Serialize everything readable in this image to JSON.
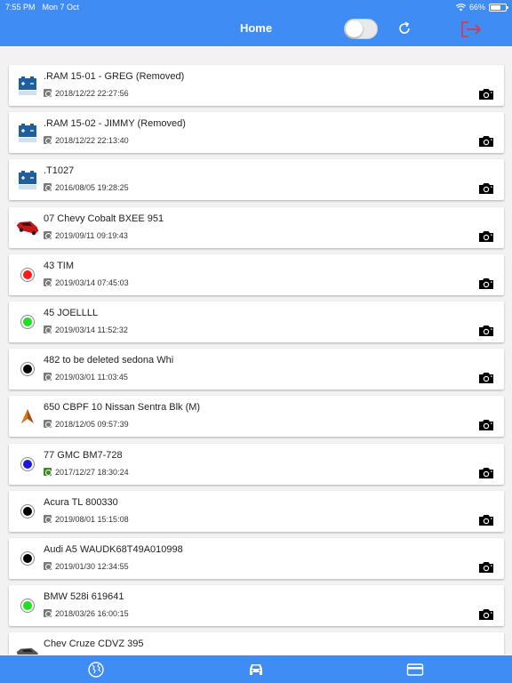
{
  "status_bar": {
    "time": "7:55 PM",
    "date": "Mon 7 Oct",
    "battery": "66%",
    "battery_level": 0.66
  },
  "nav": {
    "title": "Home",
    "toggle_on": false
  },
  "colors": {
    "accent": "#3f8cf5",
    "logout": "#e0314a"
  },
  "vehicles": [
    {
      "name": ".RAM 15-01 - GREG (Removed)",
      "date": "2018/12/22 22:27:56",
      "icon": "battery-icon",
      "date_icon": "gray"
    },
    {
      "name": ".RAM 15-02 - JIMMY (Removed)",
      "date": "2018/12/22 22:13:40",
      "icon": "battery-icon",
      "date_icon": "gray"
    },
    {
      "name": ".T1027",
      "date": "2016/08/05 19:28:25",
      "icon": "battery-icon",
      "date_icon": "gray"
    },
    {
      "name": "07 Chevy Cobalt BXEE 951",
      "date": "2019/09/11 09:19:43",
      "icon": "red-car-icon",
      "date_icon": "gray"
    },
    {
      "name": "43 TIM",
      "date": "2019/03/14 07:45:03",
      "icon": "red-dot-icon",
      "date_icon": "gray"
    },
    {
      "name": "45 JOELLLL",
      "date": "2019/03/14 11:52:32",
      "icon": "green-dot-icon",
      "date_icon": "gray"
    },
    {
      "name": "482 to be deleted sedona Whi",
      "date": "2019/03/01 11:03:45",
      "icon": "black-dot-icon",
      "date_icon": "gray"
    },
    {
      "name": "650 CBPF 10 Nissan Sentra Blk (M)",
      "date": "2018/12/05 09:57:39",
      "icon": "arrow-icon",
      "date_icon": "gray"
    },
    {
      "name": "77 GMC BM7-728",
      "date": "2017/12/27 18:30:24",
      "icon": "blue-dot-icon",
      "date_icon": "green"
    },
    {
      "name": "Acura TL 800330",
      "date": "2019/08/01 15:15:08",
      "icon": "black-dot-icon",
      "date_icon": "gray"
    },
    {
      "name": "Audi A5 WAUDK68T49A010998",
      "date": "2019/01/30 12:34:55",
      "icon": "black-dot-icon",
      "date_icon": "gray"
    },
    {
      "name": "BMW 528i 619641",
      "date": "2018/03/26 16:00:15",
      "icon": "green-dot-icon",
      "date_icon": "gray"
    },
    {
      "name": "Chev Cruze CDVZ 395",
      "date": "",
      "icon": "gray-car-icon",
      "date_icon": "gray"
    }
  ],
  "tabs": [
    {
      "icon": "globe-icon"
    },
    {
      "icon": "car-icon"
    },
    {
      "icon": "credit-card-icon"
    }
  ]
}
